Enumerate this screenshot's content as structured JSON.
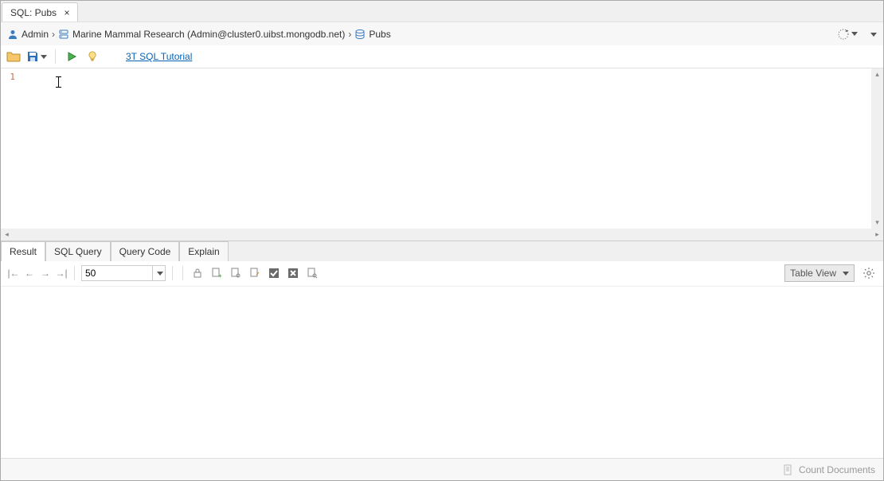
{
  "tab": {
    "title": "SQL: Pubs"
  },
  "breadcrumb": {
    "user": "Admin",
    "connection": "Marine Mammal Research (Admin@cluster0.uibst.mongodb.net)",
    "database": "Pubs"
  },
  "toolbar": {
    "tutorial_link": "3T SQL Tutorial"
  },
  "editor": {
    "line_number": "1",
    "content": ""
  },
  "result_tabs": [
    "Result",
    "SQL Query",
    "Query Code",
    "Explain"
  ],
  "result_toolbar": {
    "page_size": "50",
    "view_label": "Table View"
  },
  "status": {
    "count_label": "Count Documents"
  }
}
